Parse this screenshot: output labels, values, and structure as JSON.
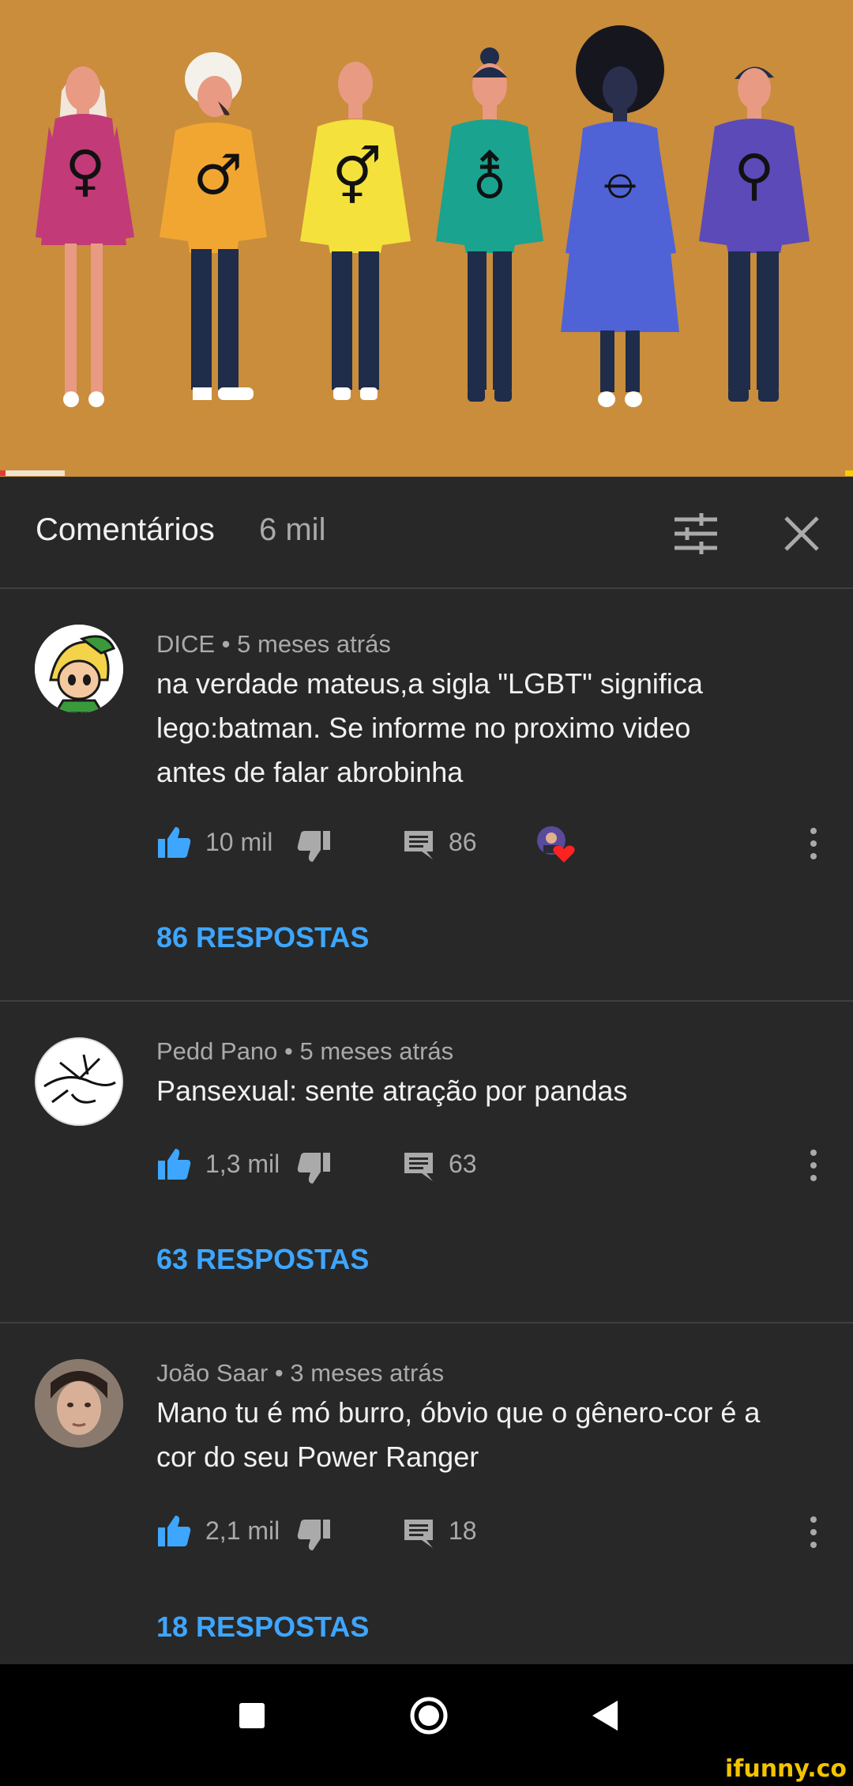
{
  "comments_header": {
    "title": "Comentários",
    "count": "6 mil"
  },
  "comments": [
    {
      "author": "DICE",
      "time": "5 meses atrás",
      "meta": "DICE • 5 meses atrás",
      "text_lines": [
        "na verdade mateus,a sigla \"LGBT\" significa",
        "lego:batman. Se informe no proximo video",
        "antes de falar abrobinha"
      ],
      "likes": "10 mil",
      "reply_count": "86",
      "creator_heart": true,
      "replies_label": "86 RESPOSTAS"
    },
    {
      "author": "Pedd Pano",
      "time": "5 meses atrás",
      "meta": "Pedd Pano • 5 meses atrás",
      "text_lines": [
        "Pansexual: sente atração por pandas"
      ],
      "likes": "1,3 mil",
      "reply_count": "63",
      "creator_heart": false,
      "replies_label": "63 RESPOSTAS"
    },
    {
      "author": "João Saar",
      "time": "3 meses atrás",
      "meta": "João Saar • 3 meses atrás",
      "text_lines": [
        "Mano tu é mó burro, óbvio que o gênero-cor é a",
        "cor do seu Power Ranger"
      ],
      "likes": "2,1 mil",
      "reply_count": "18",
      "creator_heart": false,
      "replies_label": "18 RESPOSTAS"
    }
  ],
  "video": {
    "symbols": [
      "♀",
      "♂",
      "⚥",
      "⚨",
      "⦵",
      "⚲"
    ],
    "shirt_colors": [
      "#c23a78",
      "#f2a632",
      "#f4e13c",
      "#1aa38e",
      "#4f63d6",
      "#5b4ab8"
    ],
    "background_color": "#c98d3c"
  },
  "colors": {
    "accent_blue": "#3ea6ff",
    "background": "#282828",
    "secondary_text": "#aaaaaa"
  },
  "icons": [
    "filter-icon",
    "close-icon",
    "like-icon",
    "dislike-icon",
    "reply-icon",
    "more-vert-icon",
    "heart-icon",
    "recents-icon",
    "home-icon",
    "back-icon"
  ],
  "watermark": "ifunny.co"
}
